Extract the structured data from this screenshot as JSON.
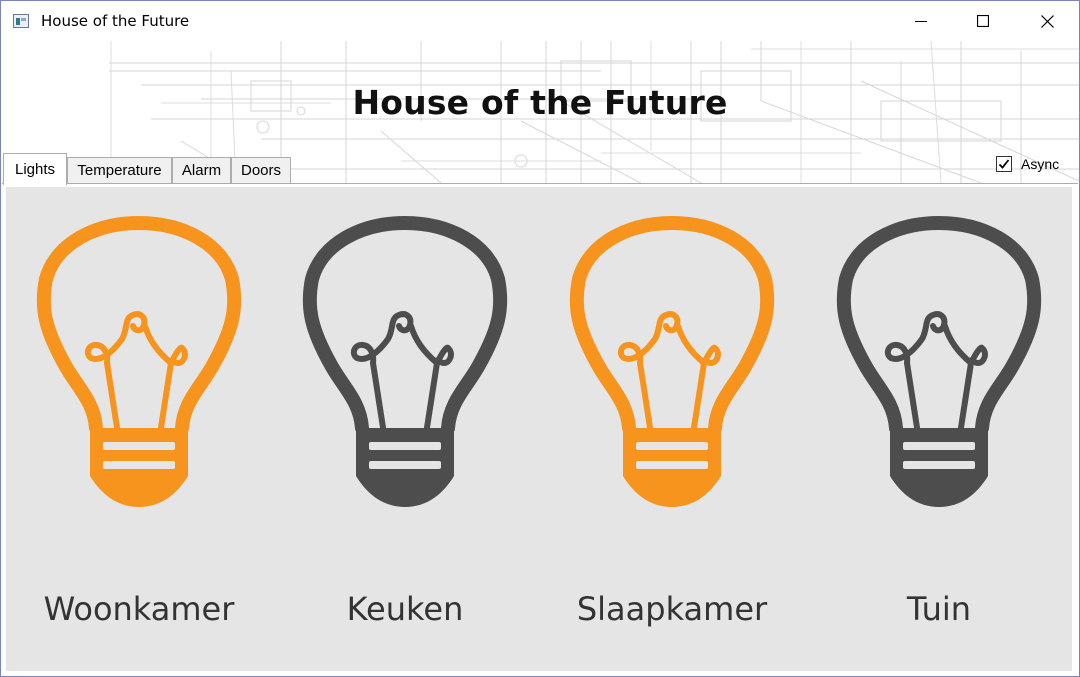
{
  "window": {
    "title": "House of the Future",
    "controls": [
      "minimize-icon",
      "maximize-icon",
      "close-icon"
    ]
  },
  "header": {
    "heading": "House of the Future",
    "async": {
      "label": "Async",
      "checked": true
    }
  },
  "tabs": [
    {
      "label": "Lights",
      "selected": true
    },
    {
      "label": "Temperature",
      "selected": false
    },
    {
      "label": "Alarm",
      "selected": false
    },
    {
      "label": "Doors",
      "selected": false
    }
  ],
  "lights": [
    {
      "room": "Woonkamer",
      "on": true
    },
    {
      "room": "Keuken",
      "on": false
    },
    {
      "room": "Slaapkamer",
      "on": true
    },
    {
      "room": "Tuin",
      "on": false
    }
  ],
  "colors": {
    "light_on": "#f7941d",
    "light_off": "#4d4d4d",
    "content_background": "#e5e5e5",
    "room_label": "#333333"
  },
  "icons": {
    "light": "lightbulb-icon",
    "checkbox": "checkmark-icon"
  }
}
